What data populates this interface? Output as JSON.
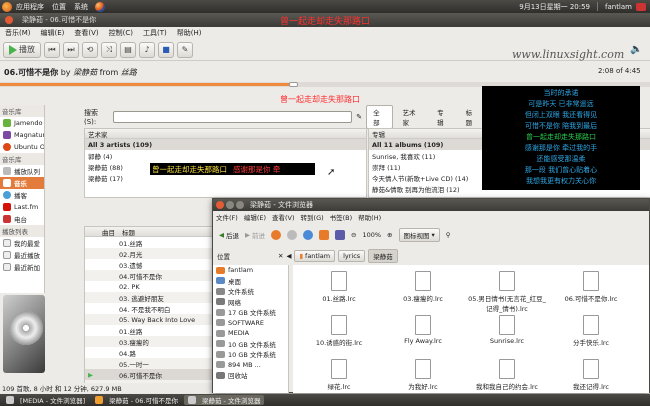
{
  "top_panel": {
    "menus": [
      "应用程序",
      "位置",
      "系统"
    ],
    "datetime": "9月13日星期一 20:59",
    "user": "fantlam"
  },
  "app": {
    "title": "梁静茹 - 06.可惜不是你",
    "menus": [
      "音乐(M)",
      "编辑(E)",
      "查看(V)",
      "控制(C)",
      "工具(T)",
      "帮助(H)"
    ],
    "play_label": "播放",
    "now_playing": {
      "title": "06.可惜不是你",
      "by": "by",
      "artist": "梁静茹",
      "from": "from",
      "album": "丝路"
    },
    "time": "2:08 of 4:45",
    "progress": 0.45
  },
  "watermark": "www.linuxsight.com",
  "osd_top": "曾一起走却走失那路口",
  "center_lyric": "曾一起走却走失那路口",
  "lyric_bar": {
    "current": "曾一起走却走失那路口",
    "next": "感谢那是你 牵"
  },
  "sidebar": {
    "heading_music": "音乐库",
    "items_top": [
      "音乐库",
      "Jamendo",
      "Magnatune",
      "Ubuntu O..."
    ],
    "heading_lib": "音乐库",
    "items_lib": [
      "播放队列",
      "音乐",
      "播客",
      "Last.fm",
      "电台"
    ],
    "heading_pl": "播放列表",
    "items_pl": [
      "我的最爱",
      "最近播放",
      "最近新加"
    ]
  },
  "search": {
    "label": "搜索(S):",
    "filters": [
      "全部",
      "艺术家",
      "专辑",
      "标题"
    ]
  },
  "artist_pane": {
    "header": "艺术家",
    "rows": [
      "All 3 artists (109)",
      "郭静 (4)",
      "梁静茹 (88)",
      "梁静茹 (17)"
    ]
  },
  "album_pane": {
    "header": "专辑",
    "rows": [
      "All 11 albums (109)",
      "Sunrise, 我喜欢 (11)",
      "崇拜 (11)",
      "今天情人节(新歌+Live CD) (14)",
      "静茹&情歌 别再为他流泪 (12)"
    ]
  },
  "tracks": {
    "col_track": "曲目",
    "col_title": "标题",
    "rows": [
      {
        "n": "",
        "t": "01.丝路"
      },
      {
        "n": "",
        "t": "02.月光"
      },
      {
        "n": "",
        "t": "03.遗憾"
      },
      {
        "n": "",
        "t": "04.可惜不是你"
      },
      {
        "n": "",
        "t": "02. PK"
      },
      {
        "n": "",
        "t": "03. 逃避好朋友"
      },
      {
        "n": "",
        "t": "04. 不是我不明白"
      },
      {
        "n": "",
        "t": "05. Way Back Into Love"
      },
      {
        "n": "",
        "t": "01.丝路"
      },
      {
        "n": "",
        "t": "03.瘦瘦的"
      },
      {
        "n": "",
        "t": "04.路"
      },
      {
        "n": "",
        "t": "05.一时一"
      },
      {
        "n": "",
        "t": "06.可惜不是你"
      },
      {
        "n": "",
        "t": "07.下一秒钟"
      },
      {
        "n": "",
        "t": "08.很久以后"
      },
      {
        "n": "",
        "t": "10.好彼晚"
      }
    ]
  },
  "status": "109 首歌, 8 小时 和 12 分钟, 627.9 MB",
  "lyrics_lines": [
    "当时的承诺",
    "可是昨天 已非常遥远",
    "但闭上双眼 我还看得见",
    "可惜不是你 陪我到最后",
    "曾一起走却走失那路口",
    "感谢那是你 牵过我的手",
    "还能感受那温柔",
    "那一段 我们曾心贴着心",
    "我想我更有权力关心你"
  ],
  "file_manager": {
    "title": "梁静茹 - 文件浏览器",
    "menus": [
      "文件(F)",
      "编辑(E)",
      "查看(V)",
      "转到(G)",
      "书签(B)",
      "帮助(H)"
    ],
    "back": "后退",
    "forward": "前进",
    "zoom": "100%",
    "view": "图标视图",
    "location": "位置",
    "crumbs": [
      "fantlam",
      "lyrics",
      "梁静茹"
    ],
    "places": [
      "fantlam",
      "桌面",
      "文件系统",
      "网络",
      "17 GB 文件系统",
      "SOFTWARE",
      "MEDIA",
      "10 GB 文件系统",
      "10 GB 文件系统",
      "894 MB ...",
      "回收站"
    ],
    "files": [
      "01.丝路.lrc",
      "03.瘦瘦的.lrc",
      "05.男日情书(无言花_红豆_记得_情书).lrc",
      "06.可惜不是你.lrc",
      "10.诱惑的街.lrc",
      "Fly Away.lrc",
      "Sunrise.lrc",
      "分手快乐.lrc",
      "绿花.lrc",
      "为我好.lrc",
      "我和我自己的约会.lrc",
      "我还记得.lrc"
    ]
  },
  "taskbar": [
    "[MEDIA - 文件浏览器]",
    "梁静茹 - 06.可惜不是你",
    "梁静茹 - 文件浏览器"
  ]
}
